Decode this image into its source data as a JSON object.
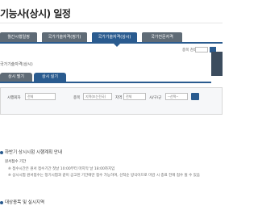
{
  "page": {
    "title": "기능사(상시) 일정"
  },
  "top_tabs": [
    {
      "label": "월간시행일정"
    },
    {
      "label": "국가기술자격(정기)"
    },
    {
      "label": "국가기술자격(상시)"
    },
    {
      "label": "국가전문자격"
    }
  ],
  "search": {
    "label": "종목 검색",
    "placeholder": ""
  },
  "breadcrumb": {
    "label": "국가기술자격(상시)"
  },
  "sub_tabs": [
    {
      "label": "상시 필기"
    },
    {
      "label": "상시 실기"
    }
  ],
  "filters": {
    "place_label": "시행회차",
    "place_value": "전체",
    "org_label": "종목",
    "org_value": "지역(또는전국)",
    "region_label": "지역",
    "region_value": "전체",
    "district_label": "시/구/군",
    "district_value": "--선택--",
    "search_button": "검색"
  },
  "sections": {
    "plan_title": "하반기 상시시험 시행계획 안내",
    "receipt_title": "원서접수 기간",
    "notice_1": "※ 접수시간은 원서 접수기간 첫날 10:00부터 마지막 날 18:00까지임",
    "notice_2": "※ 상시시험 원서접수는 정기시험과 같이 공고된 기간에만 접수 가능하며, 선착순 방식이므로 마감 시 종료 전에 접수 될 수 있음",
    "venue_title": "대상종목 및 실시지역"
  }
}
